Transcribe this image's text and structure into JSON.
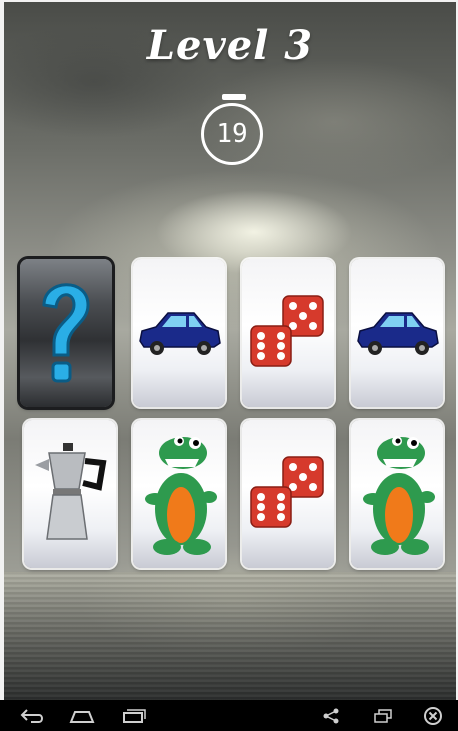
{
  "game": {
    "title": "Level 3",
    "timer": "19"
  },
  "cards": [
    {
      "state": "face-down",
      "icon": "question-mark"
    },
    {
      "state": "face-up",
      "icon": "blue-car"
    },
    {
      "state": "face-up",
      "icon": "red-dice"
    },
    {
      "state": "face-up",
      "icon": "blue-car"
    },
    {
      "state": "face-up",
      "icon": "coffee-moka-pot"
    },
    {
      "state": "face-up",
      "icon": "green-dinosaur-toy"
    },
    {
      "state": "face-up",
      "icon": "red-dice"
    },
    {
      "state": "face-up",
      "icon": "green-dinosaur-toy"
    }
  ],
  "navbar": {
    "icons": [
      "back-icon",
      "home-icon",
      "recent-apps-icon",
      "share-icon",
      "window-icon",
      "close-icon"
    ]
  },
  "colors": {
    "card_back_question": "#29a8e0",
    "car": "#1a2a8a",
    "dice": "#d63a2c",
    "dino_green": "#2e9a4e",
    "dino_orange": "#f07a1a"
  }
}
